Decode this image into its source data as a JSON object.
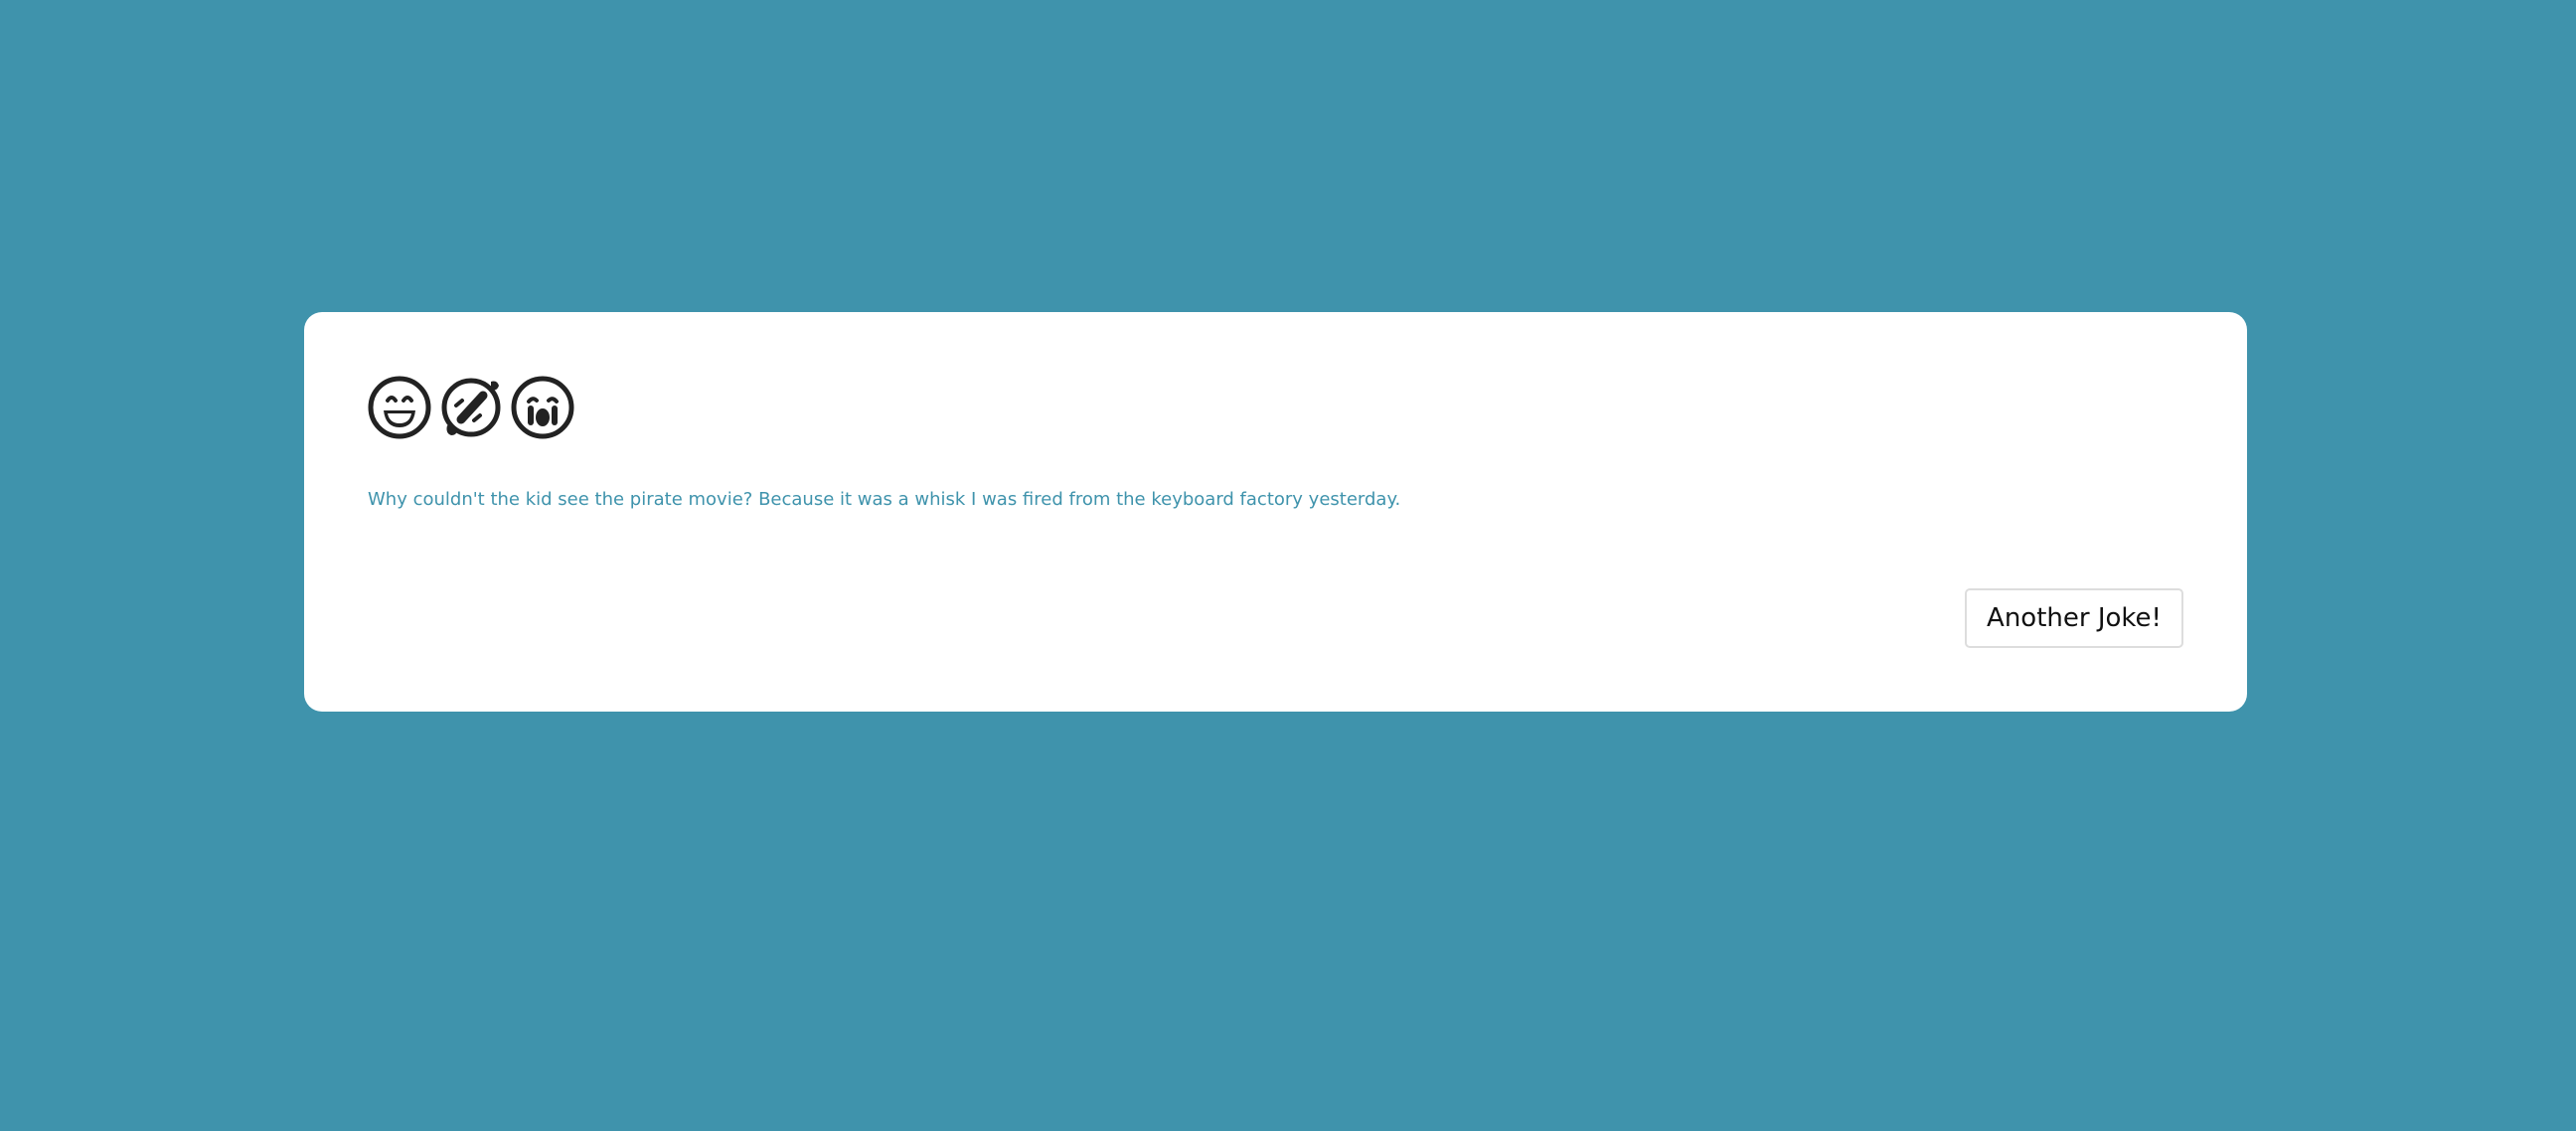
{
  "theme": {
    "background": "#3f93ac",
    "card_background": "#ffffff",
    "joke_text_color": "#3f93ac",
    "icon_color": "#222222"
  },
  "card": {
    "icons": [
      "grinning-face-icon",
      "rolling-on-floor-laughing-icon",
      "screaming-face-icon"
    ],
    "joke_text": "Why couldn't the kid see the pirate movie? Because it was a whisk I was fired from the keyboard factory yesterday.",
    "button_label": "Another Joke!"
  }
}
